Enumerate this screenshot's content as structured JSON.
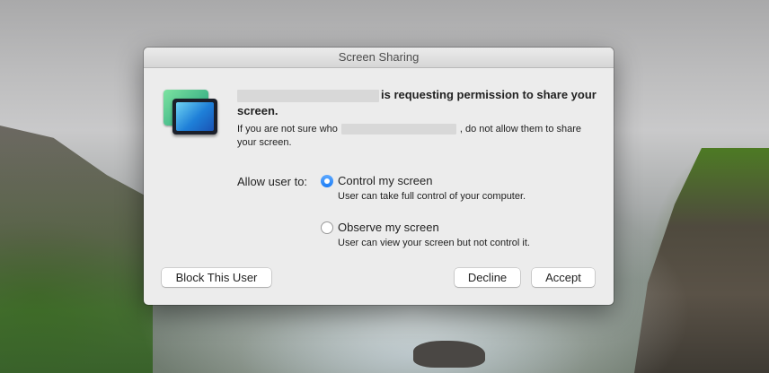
{
  "dialog": {
    "title": "Screen Sharing",
    "headline_text": "is requesting permission to share your screen.",
    "warning_before": "If you are not sure who",
    "warning_after": ", do not allow them to share your screen.",
    "allow_label": "Allow user to:",
    "options": [
      {
        "label": "Control my screen",
        "description": "User can take full control of your computer.",
        "selected": true
      },
      {
        "label": "Observe my screen",
        "description": "User can view your screen but not control it.",
        "selected": false
      }
    ],
    "buttons": {
      "block": "Block This User",
      "decline": "Decline",
      "accept": "Accept"
    }
  },
  "icons": {
    "app": "screen-sharing-icon"
  },
  "colors": {
    "accent": "#1b7cf5"
  }
}
